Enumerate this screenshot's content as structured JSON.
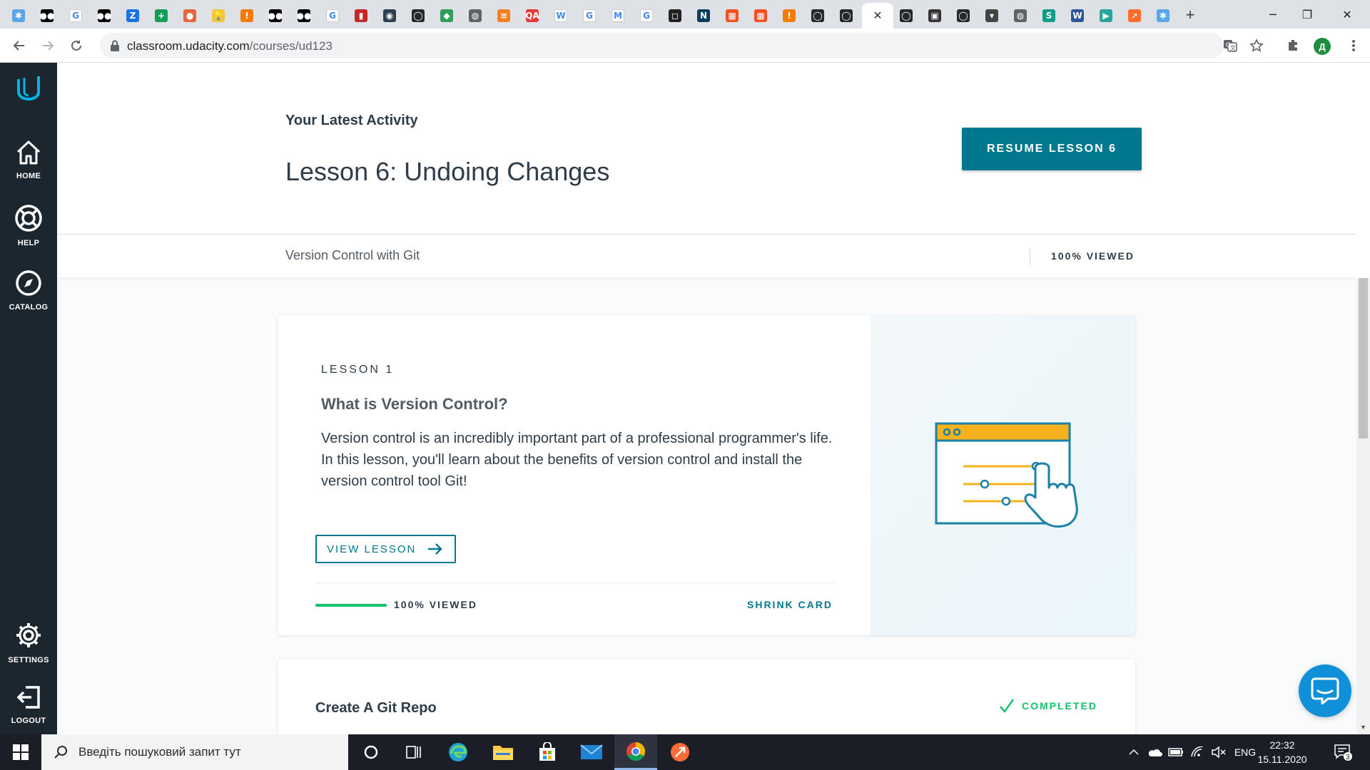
{
  "browser": {
    "tabs": [
      {
        "icon": "udacity-icon",
        "color": "#5aa6e6",
        "glyph": "✱"
      },
      {
        "icon": "medium-icon",
        "color": "#000000",
        "glyph": "●●"
      },
      {
        "icon": "google-icon",
        "color": "#ffffff",
        "glyph": "G"
      },
      {
        "icon": "medium-icon",
        "color": "#000000",
        "glyph": "●●"
      },
      {
        "icon": "translate-icon",
        "color": "#1a73e8",
        "glyph": "Z"
      },
      {
        "icon": "sheets-plus-icon",
        "color": "#0f9d58",
        "glyph": "+"
      },
      {
        "icon": "orange-circle-icon",
        "color": "#e8663c",
        "glyph": "●"
      },
      {
        "icon": "lightbulb-icon",
        "color": "#f5c542",
        "glyph": "💡"
      },
      {
        "icon": "orange-shield-icon",
        "color": "#f57c00",
        "glyph": "!"
      },
      {
        "icon": "medium-icon",
        "color": "#000000",
        "glyph": "●●"
      },
      {
        "icon": "medium-icon",
        "color": "#000000",
        "glyph": "●●"
      },
      {
        "icon": "google-icon",
        "color": "#ffffff",
        "glyph": "G"
      },
      {
        "icon": "red-bookmark-icon",
        "color": "#c62828",
        "glyph": "▮"
      },
      {
        "icon": "round-logo-icon",
        "color": "#2c3e50",
        "glyph": "◉"
      },
      {
        "icon": "github-icon",
        "color": "#24292e",
        "glyph": "◯"
      },
      {
        "icon": "green-shield-icon",
        "color": "#2e9e5b",
        "glyph": "◆"
      },
      {
        "icon": "globe-icon",
        "color": "#5f6368",
        "glyph": "◍"
      },
      {
        "icon": "stack-overflow-icon",
        "color": "#f48024",
        "glyph": "≡"
      },
      {
        "icon": "qa-icon",
        "color": "#e53935",
        "glyph": "QA"
      },
      {
        "icon": "wikipedia-icon",
        "color": "#ffffff",
        "glyph": "W"
      },
      {
        "icon": "google-icon",
        "color": "#ffffff",
        "glyph": "G"
      },
      {
        "icon": "gmail-icon",
        "color": "#ffffff",
        "glyph": "M"
      },
      {
        "icon": "google-icon",
        "color": "#ffffff",
        "glyph": "G"
      },
      {
        "icon": "square-icon",
        "color": "#222222",
        "glyph": "◻"
      },
      {
        "icon": "dark-app-icon",
        "color": "#0b3c5d",
        "glyph": "N"
      },
      {
        "icon": "microsoft-icon",
        "color": "#f25022",
        "glyph": "▦"
      },
      {
        "icon": "microsoft-icon",
        "color": "#f25022",
        "glyph": "▦"
      },
      {
        "icon": "orange-shield-icon",
        "color": "#f57c00",
        "glyph": "!"
      },
      {
        "icon": "github-icon",
        "color": "#24292e",
        "glyph": "◯"
      },
      {
        "icon": "github-icon",
        "color": "#24292e",
        "glyph": "◯"
      },
      {
        "icon": "active-tab",
        "active": true
      },
      {
        "icon": "github-icon",
        "color": "#24292e",
        "glyph": "◯"
      },
      {
        "icon": "dark-square-icon",
        "color": "#333333",
        "glyph": "▣"
      },
      {
        "icon": "github-icon",
        "color": "#24292e",
        "glyph": "◯"
      },
      {
        "icon": "pocket-icon",
        "color": "#444444",
        "glyph": "▾"
      },
      {
        "icon": "globe-icon",
        "color": "#5f6368",
        "glyph": "◍"
      },
      {
        "icon": "skype-icon",
        "color": "#0f9d8a",
        "glyph": "S"
      },
      {
        "icon": "word-icon",
        "color": "#2b579a",
        "glyph": "W"
      },
      {
        "icon": "play-icon",
        "color": "#26a69a",
        "glyph": "▶"
      },
      {
        "icon": "orange-compass-icon",
        "color": "#ff6d2d",
        "glyph": "➚"
      },
      {
        "icon": "udacity-icon",
        "color": "#5aa6e6",
        "glyph": "✱"
      }
    ],
    "url_host": "classroom.udacity.com",
    "url_path": "/courses/ud123",
    "profile_initial": "Д"
  },
  "sidebar": {
    "items": [
      {
        "label": "HOME"
      },
      {
        "label": "HELP"
      },
      {
        "label": "CATALOG"
      },
      {
        "label": "SETTINGS"
      },
      {
        "label": "LOGOUT"
      }
    ]
  },
  "header": {
    "latest_label": "Your Latest Activity",
    "lesson_title": "Lesson 6: Undoing Changes",
    "resume_label": "RESUME LESSON 6"
  },
  "subbar": {
    "course_name": "Version Control with Git",
    "viewed": "100% VIEWED"
  },
  "lesson_card": {
    "number": "LESSON 1",
    "name": "What is Version Control?",
    "description": "Version control is an incredibly important part of a professional programmer's life. In this lesson, you'll learn about the benefits of version control and install the version control tool Git!",
    "view_label": "VIEW LESSON",
    "viewed_label": "100% VIEWED",
    "progress_fraction": 1.0,
    "shrink_label": "SHRINK CARD"
  },
  "concept_card": {
    "title": "Create A Git Repo",
    "status": "COMPLETED"
  },
  "taskbar": {
    "search_placeholder": "Введіть пошуковий запит тут",
    "language": "ENG",
    "time": "22:32",
    "date": "15.11.2020",
    "notifications": "3"
  },
  "colors": {
    "accent": "#02788f",
    "success": "#15c26b",
    "sidebar": "#1c262f",
    "illustration_yellow": "#f5b21c"
  }
}
